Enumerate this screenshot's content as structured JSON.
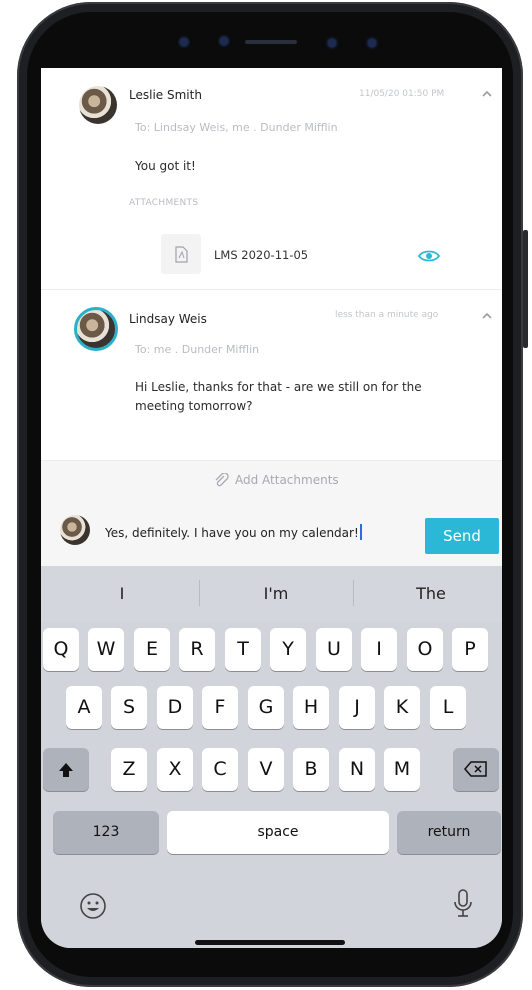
{
  "thread": {
    "messages": [
      {
        "sender": "Leslie Smith",
        "to": "To: Lindsay Weis, me . Dunder Mifflin",
        "timestamp": "11/05/20 01:50 PM",
        "body": "You got it!",
        "attachments_label": "ATTACHMENTS",
        "attachment_name": "LMS 2020-11-05"
      },
      {
        "sender": "Lindsay Weis",
        "to": "To: me . Dunder Mifflin",
        "timestamp": "less than a minute ago",
        "body_line1": "Hi Leslie, thanks for that - are we still on for the",
        "body_line2": "meeting tomorrow?"
      }
    ]
  },
  "add_attachments_label": "Add Attachments",
  "compose": {
    "value": "Yes, definitely. I have you on my calendar!",
    "send_label": "Send"
  },
  "keyboard": {
    "suggestions": [
      "I",
      "I'm",
      "The"
    ],
    "row1": [
      "Q",
      "W",
      "E",
      "R",
      "T",
      "Y",
      "U",
      "I",
      "O",
      "P"
    ],
    "row2": [
      "A",
      "S",
      "D",
      "F",
      "G",
      "H",
      "J",
      "K",
      "L"
    ],
    "row3": [
      "Z",
      "X",
      "C",
      "V",
      "B",
      "N",
      "M"
    ],
    "numbers_label": "123",
    "space_label": "space",
    "return_label": "return"
  },
  "colors": {
    "accent": "#2bb8d6",
    "ring": "#2bb0c9"
  }
}
